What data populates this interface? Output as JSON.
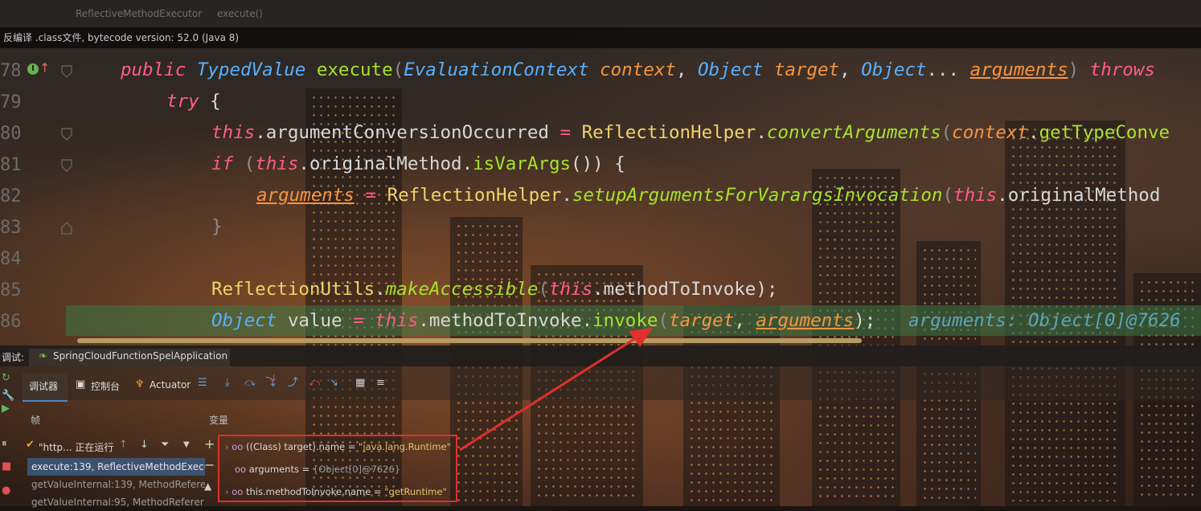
{
  "editor_tabs": {
    "tab1": "ReflectiveMethodExecutor",
    "tab2": "execute()"
  },
  "banner": {
    "text": "反编译 .class文件, bytecode version: 52.0 (Java 8)"
  },
  "gutter": {
    "lines": [
      "78",
      "79",
      "80",
      "81",
      "82",
      "83",
      "84",
      "85",
      "86"
    ]
  },
  "code": {
    "l78": {
      "kw_public": "public",
      "type_typedvalue": "TypedValue",
      "method_execute": "execute",
      "paren_open": "(",
      "type_evalctx": "EvaluationContext",
      "param_context": "context",
      "comma1": ", ",
      "type_object1": "Object",
      "param_target": "target",
      "comma2": ", ",
      "type_object2": "Object",
      "varargs": "...",
      "param_arguments": "arguments",
      "paren_close": ")",
      "kw_throws": "throws"
    },
    "l79": {
      "kw_try": "try",
      "brace": " {"
    },
    "l80": {
      "kw_this": "this",
      "field": ".argumentConversionOccurred",
      "assign": " = ",
      "cls": "ReflectionHelper",
      "dot": ".",
      "smethod": "convertArguments",
      "paren": "(",
      "param": "context",
      "dot2": ".",
      "method": "getTypeConve"
    },
    "l81": {
      "kw_if": "if",
      "paren": " (",
      "kw_this": "this",
      "field": ".originalMethod.",
      "method": "isVarArgs",
      "tail": "()) {"
    },
    "l82": {
      "param": "arguments",
      "assign": " = ",
      "cls": "ReflectionHelper",
      "dot": ".",
      "smethod": "setupArgumentsForVarargsInvocation",
      "paren": "(",
      "kw_this": "this",
      "field": ".originalMethod"
    },
    "l83": {
      "brace": "}"
    },
    "l85": {
      "cls": "ReflectionUtils",
      "dot": ".",
      "smethod": "makeAccessible",
      "paren": "(",
      "kw_this": "this",
      "field": ".methodToInvoke",
      "tail": ");"
    },
    "l86": {
      "type_object": "Object",
      "var": " value",
      "assign": " = ",
      "kw_this": "this",
      "field": ".methodToInvoke.",
      "method": "invoke",
      "paren": "(",
      "param_target": "target",
      "comma": ", ",
      "param_arguments": "arguments",
      "tail": ");",
      "hint": "arguments: Object[0]@7626"
    }
  },
  "debug": {
    "panel_label": "调试:",
    "run_config": "SpringCloudFunctionSpelApplication",
    "tabs": {
      "debugger": "调试器",
      "console": "控制台",
      "actuator": "Actuator"
    },
    "frames_header": "帧",
    "vars_header": "变量",
    "thread": "\"http... 正在运行",
    "frames": [
      "execute:139, ReflectiveMethodExecu",
      "getValueInternal:139, MethodRefere",
      "getValueInternal:95, MethodReferer"
    ],
    "variables": [
      {
        "name": "((Class) target).name",
        "eq": " = ",
        "value": "\"java.lang.Runtime\""
      },
      {
        "name": "arguments",
        "eq": " = ",
        "value": "{Object[0]@7626}"
      },
      {
        "name": "this.methodToInvoke.name",
        "eq": " = ",
        "value": "\"getRuntime\""
      }
    ]
  },
  "colors": {
    "keyword": "#ff5c8a",
    "type": "#58b0ff",
    "class": "#f1d36a",
    "method": "#a6e22e",
    "param": "#f59542",
    "current_line": "#3c7846",
    "highlight_box": "#e0302c",
    "arrow": "#e0302c"
  }
}
